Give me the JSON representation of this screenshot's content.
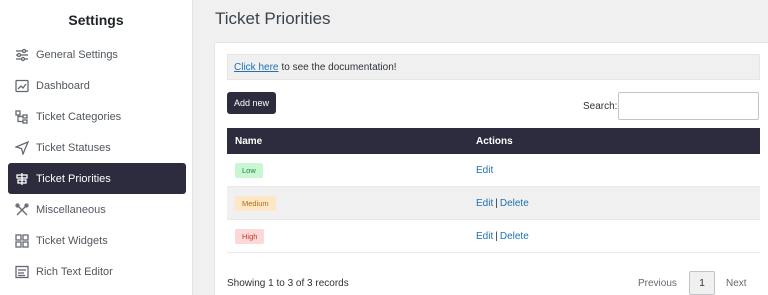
{
  "sidebar": {
    "title": "Settings",
    "items": [
      {
        "label": "General Settings",
        "icon": "sliders-icon",
        "active": false
      },
      {
        "label": "Dashboard",
        "icon": "chart-icon",
        "active": false
      },
      {
        "label": "Ticket Categories",
        "icon": "tree-icon",
        "active": false
      },
      {
        "label": "Ticket Statuses",
        "icon": "send-icon",
        "active": false
      },
      {
        "label": "Ticket Priorities",
        "icon": "priority-icon",
        "active": true
      },
      {
        "label": "Miscellaneous",
        "icon": "tools-icon",
        "active": false
      },
      {
        "label": "Ticket Widgets",
        "icon": "widgets-icon",
        "active": false
      },
      {
        "label": "Rich Text Editor",
        "icon": "editor-icon",
        "active": false
      }
    ]
  },
  "main": {
    "title": "Ticket Priorities",
    "doc_link": "Click here",
    "doc_text": "to see the documentation!",
    "add_button": "Add new",
    "search_label": "Search:",
    "search_value": "",
    "table": {
      "headers": [
        "Name",
        "Actions"
      ],
      "rows": [
        {
          "name": "Low",
          "color": "#c8f7d2",
          "actions": [
            "Edit"
          ]
        },
        {
          "name": "Medium",
          "color": "#fde7c6",
          "actions": [
            "Edit",
            "Delete"
          ]
        },
        {
          "name": "High",
          "color": "#fdd8d8",
          "actions": [
            "Edit",
            "Delete"
          ]
        }
      ]
    },
    "footer_info": "Showing 1 to 3 of 3 records",
    "pagination": {
      "previous": "Previous",
      "current": "1",
      "next": "Next"
    }
  },
  "colors": {
    "accent": "#2c2c3e",
    "link": "#2271b1"
  }
}
